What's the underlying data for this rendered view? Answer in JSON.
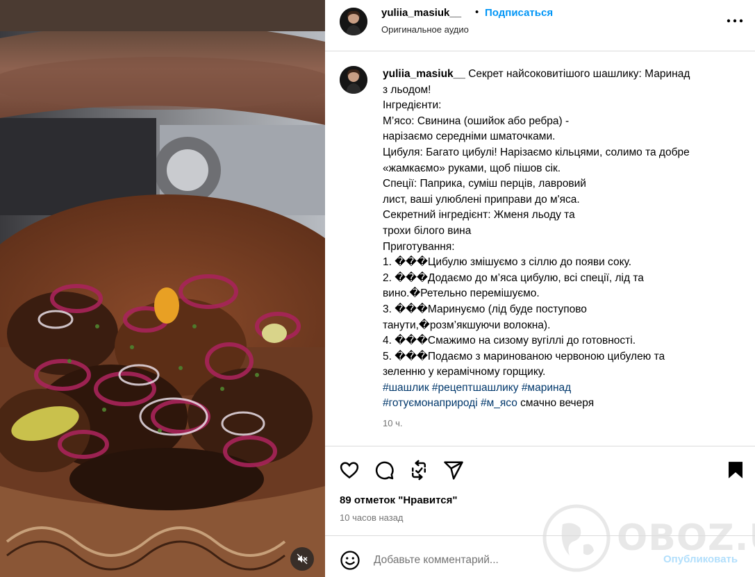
{
  "media": {
    "icons": {
      "mute": "speaker-muted-icon"
    }
  },
  "header": {
    "username": "yuliia_masiuk__",
    "separator": "•",
    "follow_label": "Подписаться",
    "audio_label": "Оригинальное аудио",
    "more_icon": "more-horizontal-icon"
  },
  "caption": {
    "username": "yuliia_masiuk__",
    "lines": [
      "Секрет найсоковитішого шашлику: Маринад",
      "з льодом!",
      "Інгредієнти:",
      "М’ясо: Свинина (ошийок або ребра) -",
      "нарізаємо середніми шматочками.",
      "Цибуля: Багато цибулі! Нарізаємо кільцями, солимо та добре",
      "«жамкаємо» руками, щоб пішов сік.",
      "Спеції: Паприка, суміш перців, лавровий",
      "лист, ваші улюблені приправи до м'яса.",
      "Секретний інгредієнт: Жменя льоду та",
      "трохи білого вина",
      "Приготування:",
      "1. ���Цибулю змішуємо з сіллю до появи соку.",
      "2. ���Додаємо до м’яса цибулю, всі спеції, лід та",
      "вино.�Ретельно перемішуємо.",
      "3. ���Маринуємо (лід буде поступово",
      "танути,�розм’якшуючи волокна).",
      "4. ���Смажимо на сизому вугіллі до готовності.",
      "5. ���Подаємо з маринованою червоною цибулею та",
      "зеленню у керамічному горщику."
    ],
    "hashtags_line1": [
      "#шашлик",
      "#рецептшашлику",
      "#маринад"
    ],
    "hashtags_line2": [
      "#готуємонаприроді",
      "#м_ясо"
    ],
    "trailing_text": "смачно вечеря",
    "time": "10 ч."
  },
  "actions": {
    "icons": [
      "heart-icon",
      "comment-icon",
      "repost-icon",
      "share-icon",
      "bookmark-icon"
    ]
  },
  "likes_label": "89 отметок \"Нравится\"",
  "time_ago": "10 часов назад",
  "comment": {
    "placeholder": "Добавьте комментарий...",
    "publish_label": "Опубликовать",
    "emoji_icon": "emoji-icon"
  },
  "watermark": {
    "text": "OBOZ.UA"
  },
  "colors": {
    "link_blue": "#0095f6",
    "hashtag": "#00376b",
    "publish_disabled": "#b2dffc",
    "muted_text": "#737373",
    "divider": "#dbdbdb"
  }
}
